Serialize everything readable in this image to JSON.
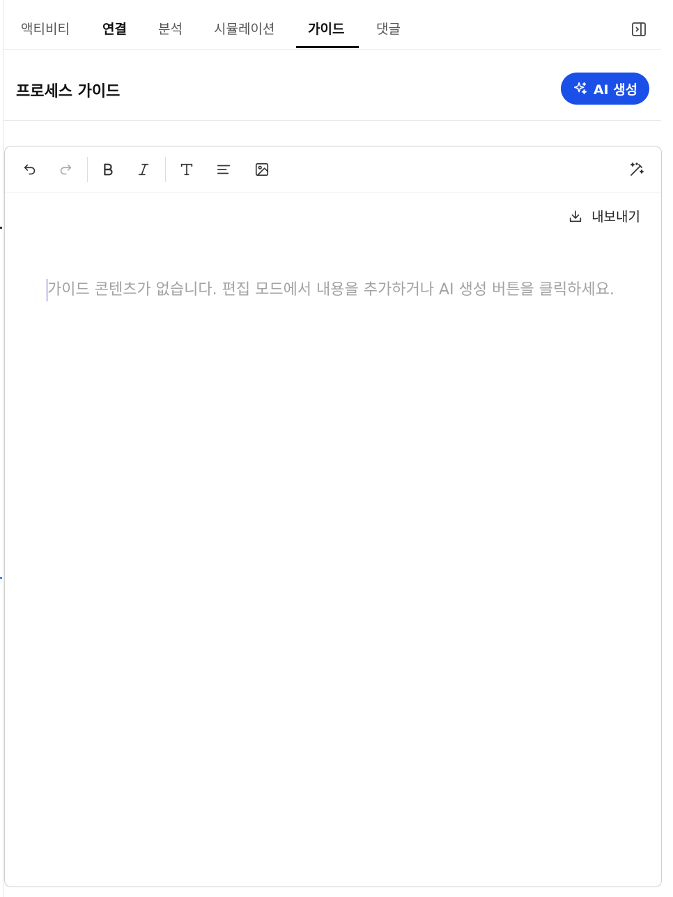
{
  "tabs": [
    {
      "label": "액티비티"
    },
    {
      "label": "연결"
    },
    {
      "label": "분석"
    },
    {
      "label": "시뮬레이션"
    },
    {
      "label": "가이드"
    },
    {
      "label": "댓글"
    }
  ],
  "active_tab": "가이드",
  "header": {
    "title": "프로세스 가이드",
    "ai_button_label": "AI 생성"
  },
  "editor": {
    "export_label": "내보내기",
    "placeholder": "가이드 콘텐츠가 없습니다. 편집 모드에서 내용을 추가하거나 AI 생성 버튼을 클릭하세요."
  },
  "colors": {
    "accent": "#1a4fe8",
    "placeholder_text": "#a3a3a3"
  },
  "icons": {
    "undo": "undo-icon",
    "redo": "redo-icon",
    "bold": "bold-icon",
    "italic": "italic-icon",
    "text": "text-icon",
    "align": "align-left-icon",
    "image": "image-icon",
    "magic": "magic-wand-icon",
    "export": "download-icon",
    "ai": "sparkles-icon",
    "collapse": "panel-collapse-icon"
  }
}
